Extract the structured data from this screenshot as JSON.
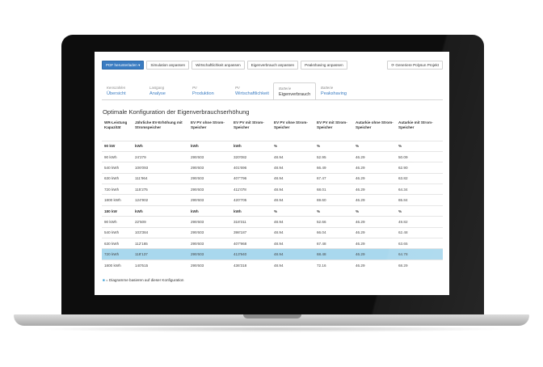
{
  "toolbar": {
    "buttons": [
      {
        "label": "PDF herunterladen ▾",
        "primary": true
      },
      {
        "label": "Simulation anpassen"
      },
      {
        "label": "Wirtschaftlichkeit anpassen"
      },
      {
        "label": "Eigenverbrauch anpassen"
      },
      {
        "label": "Peakshaving anpassen"
      }
    ],
    "generate_label": "⟳ Generiere Polysun Projekt"
  },
  "tabs": [
    {
      "kicker": "Kennzahlen",
      "label": "Übersicht"
    },
    {
      "kicker": "Lastgang",
      "label": "Analyse"
    },
    {
      "kicker": "PV",
      "label": "Produktion"
    },
    {
      "kicker": "PV",
      "label": "Wirtschaftlichkeit"
    },
    {
      "kicker": "Batterie",
      "label": "Eigenverbrauch",
      "active": true
    },
    {
      "kicker": "Batterie",
      "label": "Peakshaving"
    }
  ],
  "heading": "Optimale Konfiguration der Eigenverbrauchserhöhung",
  "table": {
    "headers": [
      "WR-Leistung\nKapazität",
      "Jährliche EV-Erhöhung mit Stromspeicher",
      "EV PV ohne Strom-Speicher",
      "EV PV mit Strom-Speicher",
      "EV PV ohne Strom-Speicher",
      "EV PV mit Strom-Speicher",
      "Autarkie ohne Strom-Speicher",
      "Autarkie mit Strom-Speicher"
    ],
    "rows": [
      {
        "group": true,
        "cells": [
          "90 kW",
          "kWh",
          "kWh",
          "kWh",
          "%",
          "%",
          "%",
          "%"
        ]
      },
      {
        "cells": [
          "90 kWh",
          "24'279",
          "295'603",
          "320'082",
          "48.94",
          "52.95",
          "46.29",
          "50.09"
        ]
      },
      {
        "cells": [
          "540 kWh",
          "106'093",
          "295'603",
          "401'696",
          "48.94",
          "66.49",
          "46.29",
          "62.90"
        ]
      },
      {
        "cells": [
          "630 kWh",
          "111'964",
          "295'603",
          "407'796",
          "48.94",
          "67.47",
          "46.29",
          "63.82"
        ]
      },
      {
        "cells": [
          "720 kWh",
          "115'275",
          "295'603",
          "411'078",
          "48.94",
          "68.01",
          "46.29",
          "64.34"
        ]
      },
      {
        "cells": [
          "1800 kWh",
          "124'902",
          "295'603",
          "420'705",
          "48.94",
          "69.60",
          "46.29",
          "65.84"
        ]
      },
      {
        "group": true,
        "cells": [
          "180 kW",
          "kWh",
          "kWh",
          "kWh",
          "%",
          "%",
          "%",
          "%"
        ]
      },
      {
        "cells": [
          "90 kWh",
          "22'509",
          "295'603",
          "318'311",
          "48.94",
          "52.66",
          "46.29",
          "49.82"
        ]
      },
      {
        "cells": [
          "540 kWh",
          "103'384",
          "295'603",
          "398'187",
          "48.94",
          "66.04",
          "46.29",
          "62.48"
        ]
      },
      {
        "cells": [
          "630 kWh",
          "112'165",
          "295'603",
          "407'968",
          "48.94",
          "67.48",
          "46.29",
          "63.65"
        ]
      },
      {
        "selected": true,
        "cells": [
          "720 kWh",
          "118'137",
          "295'603",
          "413'940",
          "48.94",
          "68.48",
          "46.29",
          "64.78"
        ]
      },
      {
        "cells": [
          "1800 kWh",
          "140'515",
          "295'603",
          "436'318",
          "48.94",
          "72.16",
          "46.29",
          "68.29"
        ]
      }
    ]
  },
  "footnote": {
    "mark": "■",
    "text": " = Diagramme basieren auf dieser Konfiguration"
  }
}
